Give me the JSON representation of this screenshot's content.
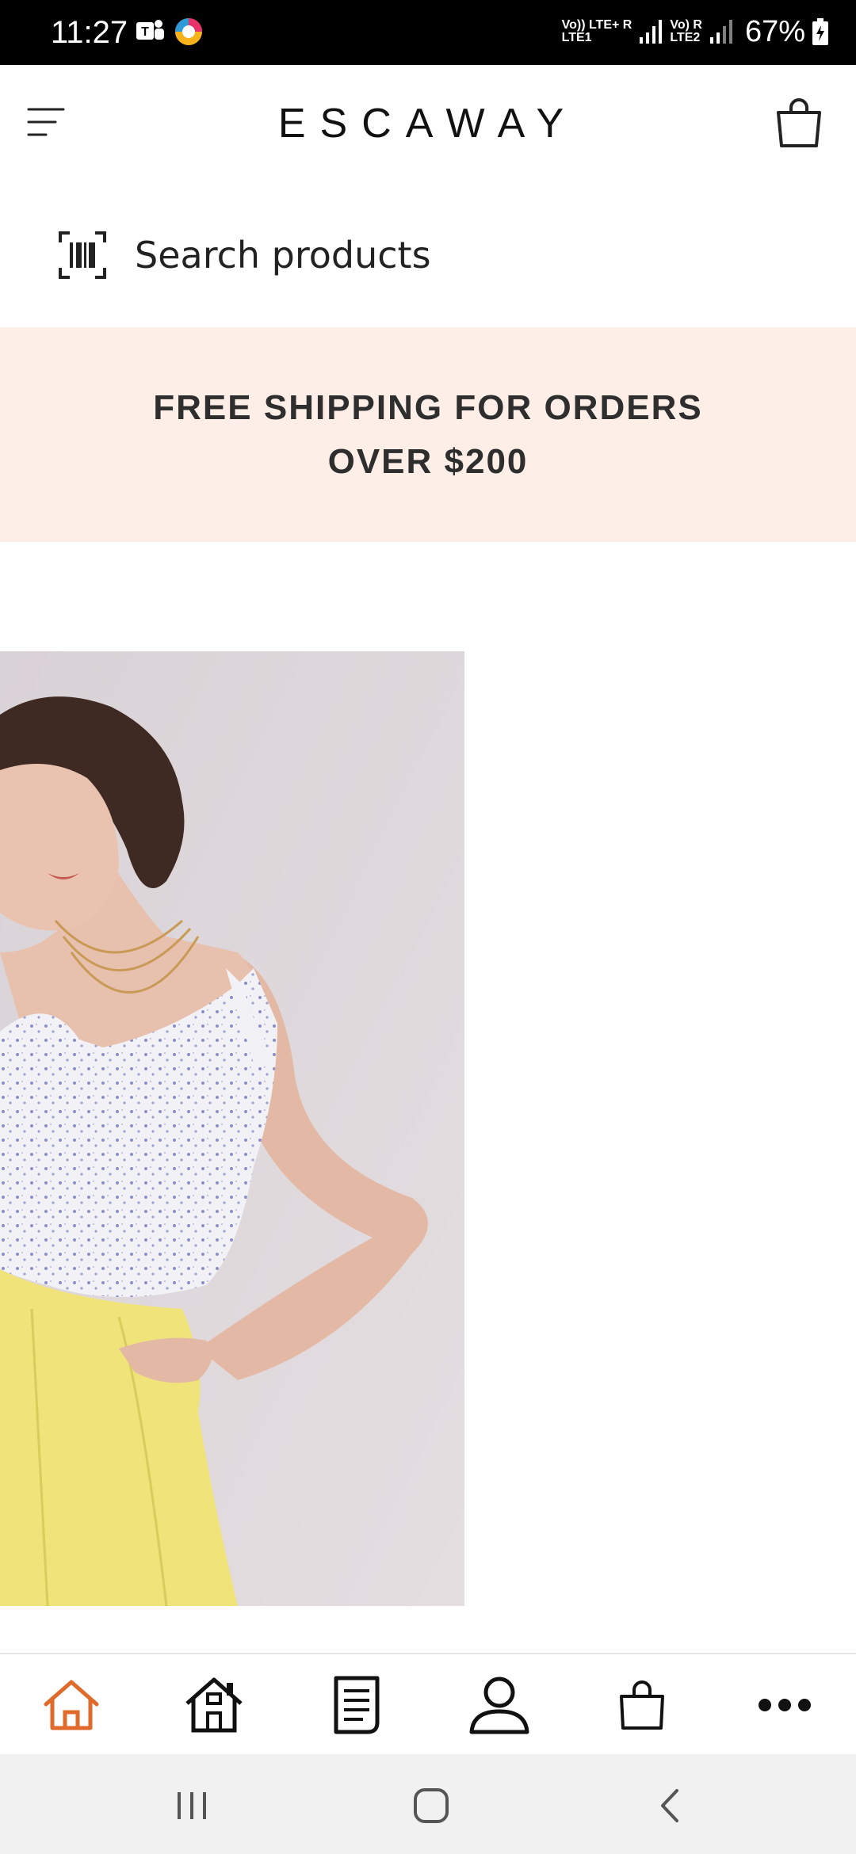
{
  "status_bar": {
    "time": "11:27",
    "sim1_label_top": "Vo)) LTE+ R",
    "sim1_label_bottom": "LTE1",
    "sim2_label_top": "Vo) R",
    "sim2_label_bottom": "LTE2",
    "battery_percent": "67%",
    "app_icons": [
      "teams-icon",
      "app-circle-icon"
    ]
  },
  "header": {
    "brand": "ESCAWAY",
    "menu_icon": "menu-icon",
    "cart_icon": "shopping-bag-icon"
  },
  "search": {
    "placeholder": "Search products",
    "icon": "barcode-icon"
  },
  "promo": {
    "line1": "FREE SHIPPING FOR ORDERS",
    "line2": "OVER $200",
    "background": "#fdeee8"
  },
  "bottom_nav": {
    "active_color": "#e06a2b",
    "items": [
      {
        "name": "home",
        "icon": "home-icon",
        "active": true
      },
      {
        "name": "store",
        "icon": "house-icon",
        "active": false
      },
      {
        "name": "orders",
        "icon": "document-icon",
        "active": false
      },
      {
        "name": "account",
        "icon": "user-icon",
        "active": false
      },
      {
        "name": "bag",
        "icon": "shopping-bag-icon",
        "active": false
      },
      {
        "name": "more",
        "icon": "more-dots-icon",
        "active": false
      }
    ]
  },
  "system_nav": {
    "buttons": [
      "recent-apps-icon",
      "home-circle-icon",
      "back-icon"
    ]
  }
}
